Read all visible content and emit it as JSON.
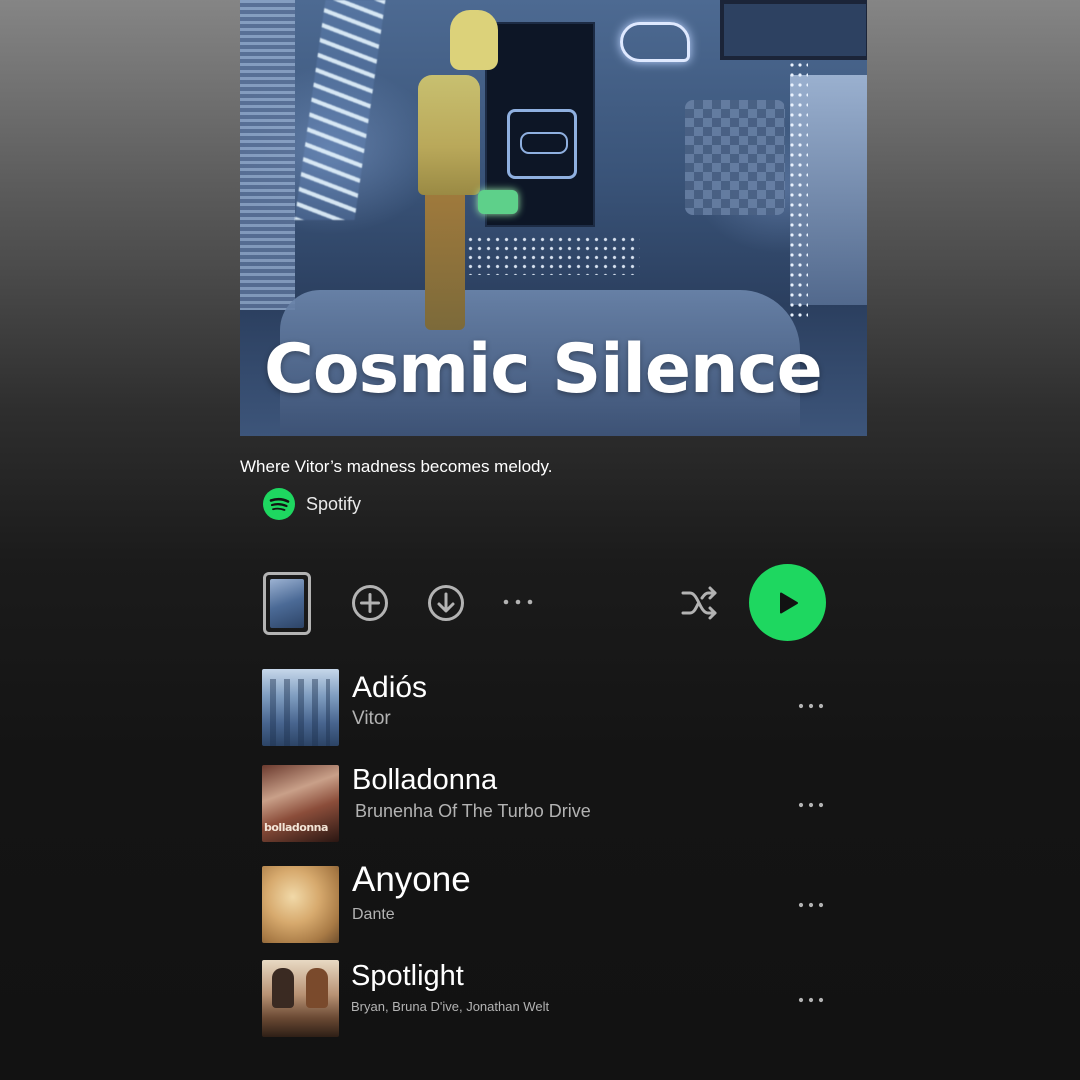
{
  "playlist": {
    "title": "Cosmic Silence",
    "description": "Where Vitor’s madness becomes melody.",
    "owner": "Spotify"
  },
  "actions": {
    "add": "add-circle-icon",
    "download": "download-icon",
    "more": "more-icon",
    "shuffle": "shuffle-icon",
    "play": "play-icon"
  },
  "colors": {
    "accent": "#1ed760",
    "text_primary": "#ffffff",
    "text_secondary": "#b3b3b3",
    "background": "#121212"
  },
  "tracks": [
    {
      "title": "Adiós",
      "artist": "Vitor"
    },
    {
      "title": "Bolladonna",
      "artist": "Brunenha Of The Turbo Drive"
    },
    {
      "title": "Anyone",
      "artist": "Dante"
    },
    {
      "title": "Spotlight",
      "artist": "Bryan, Bruna D'ive, Jonathan Welt"
    }
  ]
}
